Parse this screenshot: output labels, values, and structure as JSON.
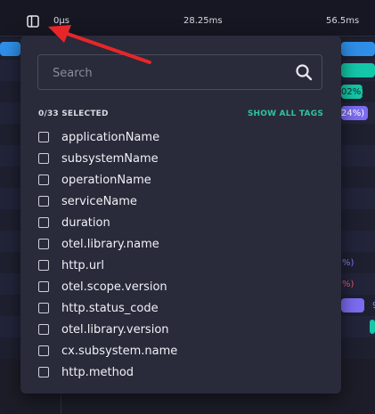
{
  "timeline": {
    "ticks": [
      "0µs",
      "28.25ms",
      "56.5ms"
    ]
  },
  "background_labels": [
    "02%)",
    "24%)",
    "%)",
    "%)",
    "9"
  ],
  "tag_filter": {
    "search_placeholder": "Search",
    "selected_count": "0/33 SELECTED",
    "show_all_label": "SHOW ALL TAGS",
    "tags": [
      "applicationName",
      "subsystemName",
      "operationName",
      "serviceName",
      "duration",
      "otel.library.name",
      "http.url",
      "otel.scope.version",
      "http.status_code",
      "otel.library.version",
      "cx.subsystem.name",
      "http.method"
    ]
  },
  "colors": {
    "accent": "#2ec4a2",
    "bar_blue": "#2f8fe8",
    "bar_purple": "#7c6cf2",
    "annotation": "#e8262a"
  }
}
